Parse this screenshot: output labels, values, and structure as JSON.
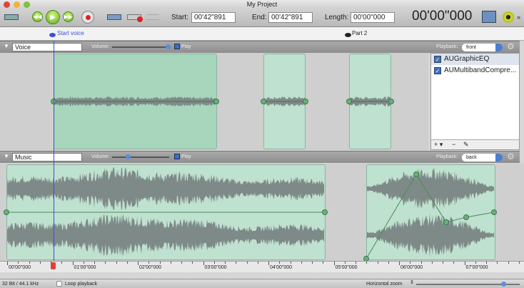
{
  "window": {
    "title": "My Project"
  },
  "toolbar": {
    "start_label": "Start:",
    "start_value": "00'42\"891",
    "end_label": "End:",
    "end_value": "00'42\"891",
    "length_label": "Length:",
    "length_value": "00'00\"000",
    "current_time": "00'00\"000"
  },
  "markers": [
    {
      "label": "Start voice",
      "color": "#3b4fd8"
    },
    {
      "label": "Part 2",
      "color": "#222222"
    }
  ],
  "tracks": [
    {
      "name": "Voice",
      "volume_label": "Volume:",
      "volume": 1.0,
      "play_label": "Play",
      "play_checked": true,
      "playback_label": "Playback:",
      "playback": "front"
    },
    {
      "name": "Music",
      "volume_label": "Volume:",
      "volume": 0.28,
      "play_label": "Play",
      "play_checked": true,
      "playback_label": "Playback:",
      "playback": "back"
    }
  ],
  "effects": [
    {
      "name": "AUGraphicEQ",
      "enabled": true
    },
    {
      "name": "AUMultibandCompre...",
      "enabled": true
    }
  ],
  "effects_buttons": {
    "add": "+ ▾",
    "remove": "−",
    "edit": "✎"
  },
  "ruler": [
    "00'00\"000",
    "01'00\"000",
    "02'00\"000",
    "03'00\"000",
    "04'00\"000",
    "05'00\"000",
    "06'00\"000",
    "07'00\"000"
  ],
  "status": {
    "format": "32 Bit / 44.1 kHz",
    "loop_label": "Loop playback",
    "loop_checked": false,
    "zoom_label": "Horizontal zoom",
    "zoom": 0.85
  },
  "colors": {
    "clip": "#bfe1cf",
    "playhead": "#3b4fd8",
    "wave": "#7e8a88"
  }
}
